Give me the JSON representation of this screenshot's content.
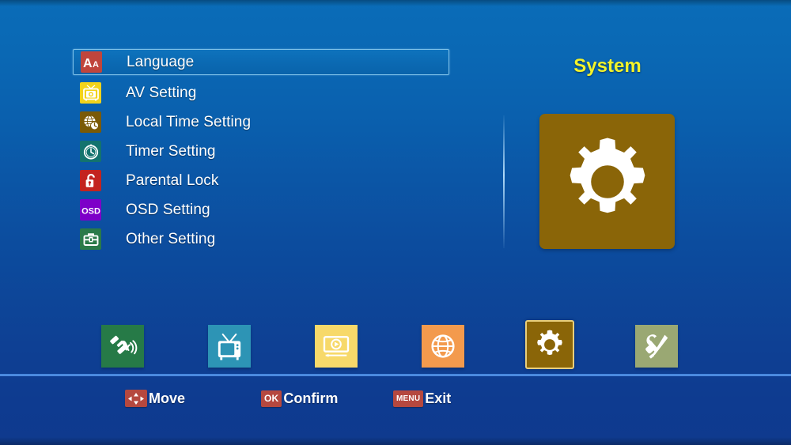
{
  "screen": {
    "title": "System",
    "title_color": "#f3f32a",
    "background_top": "#0a6cb8",
    "background_bottom": "#0f3a8e"
  },
  "menu": {
    "selected_index": 0,
    "items": [
      {
        "label": "Language",
        "icon": "font-aa-icon",
        "icon_bg": "#c0453c"
      },
      {
        "label": "AV Setting",
        "icon": "tv-camera-icon",
        "icon_bg": "#f2d31b"
      },
      {
        "label": "Local Time Setting",
        "icon": "globe-clock-icon",
        "icon_bg": "#7a5a07"
      },
      {
        "label": "Timer Setting",
        "icon": "clock-icon",
        "icon_bg": "#13736e"
      },
      {
        "label": "Parental Lock",
        "icon": "open-padlock-icon",
        "icon_bg": "#c3231f"
      },
      {
        "label": "OSD Setting",
        "icon": "osd-text-icon",
        "icon_bg": "#7d00c8"
      },
      {
        "label": "Other Setting",
        "icon": "toolbox-icon",
        "icon_bg": "#2a7a49"
      }
    ]
  },
  "panel": {
    "icon": "gear-icon",
    "tile_color": "#8a6508"
  },
  "iconbar": {
    "active_index": 4,
    "items": [
      {
        "name": "satellite-icon",
        "tile_color": "#267a47"
      },
      {
        "name": "tv-icon",
        "tile_color": "#2d94b5"
      },
      {
        "name": "media-player-icon",
        "tile_color": "#f7d96a"
      },
      {
        "name": "globe-icon",
        "tile_color": "#f39a4d"
      },
      {
        "name": "gear-icon",
        "tile_color": "#8a6508"
      },
      {
        "name": "tools-icon",
        "tile_color": "#9aa873"
      }
    ]
  },
  "helpbar": {
    "items": [
      {
        "key": "dpad-icon",
        "label": "Move"
      },
      {
        "key": "OK",
        "label": "Confirm"
      },
      {
        "key": "MENU",
        "label": "Exit"
      }
    ]
  }
}
